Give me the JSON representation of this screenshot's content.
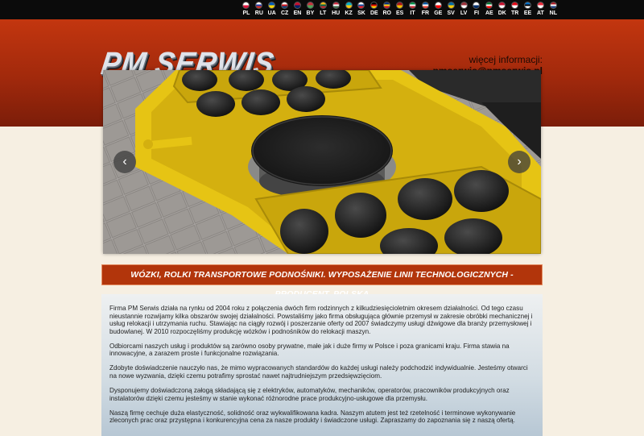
{
  "languages": [
    {
      "code": "PL",
      "colors": [
        "#ffffff",
        "#dc143c"
      ]
    },
    {
      "code": "RU",
      "colors": [
        "#ffffff",
        "#1c3fa8",
        "#d52b1e"
      ]
    },
    {
      "code": "UA",
      "colors": [
        "#0057b7",
        "#ffd700"
      ]
    },
    {
      "code": "CZ",
      "colors": [
        "#ffffff",
        "#d7141a",
        "#11457e"
      ]
    },
    {
      "code": "EN",
      "colors": [
        "#c8102e",
        "#012169"
      ]
    },
    {
      "code": "BY",
      "colors": [
        "#c8313e",
        "#4aa657"
      ]
    },
    {
      "code": "LT",
      "colors": [
        "#fdb913",
        "#006a44",
        "#c1272d"
      ]
    },
    {
      "code": "HU",
      "colors": [
        "#cd2a3e",
        "#ffffff",
        "#436f4d"
      ]
    },
    {
      "code": "KZ",
      "colors": [
        "#00afca",
        "#fec50c"
      ]
    },
    {
      "code": "SK",
      "colors": [
        "#ffffff",
        "#0b4ea2",
        "#ee1c25"
      ]
    },
    {
      "code": "DE",
      "colors": [
        "#000000",
        "#dd0000",
        "#ffce00"
      ]
    },
    {
      "code": "RO",
      "colors": [
        "#002b7f",
        "#fcd116",
        "#ce1126"
      ]
    },
    {
      "code": "ES",
      "colors": [
        "#aa151b",
        "#f1bf00"
      ]
    },
    {
      "code": "IT",
      "colors": [
        "#009246",
        "#ffffff",
        "#ce2b37"
      ]
    },
    {
      "code": "FR",
      "colors": [
        "#0055a4",
        "#ffffff",
        "#ef4135"
      ]
    },
    {
      "code": "GE",
      "colors": [
        "#ffffff",
        "#ff0000"
      ]
    },
    {
      "code": "SV",
      "colors": [
        "#006aa7",
        "#fecc00"
      ]
    },
    {
      "code": "LV",
      "colors": [
        "#9e3039",
        "#ffffff"
      ]
    },
    {
      "code": "FI",
      "colors": [
        "#ffffff",
        "#002f6c"
      ]
    },
    {
      "code": "AE",
      "colors": [
        "#00732f",
        "#ffffff",
        "#ff0000"
      ]
    },
    {
      "code": "DK",
      "colors": [
        "#c8102e",
        "#ffffff"
      ]
    },
    {
      "code": "TR",
      "colors": [
        "#e30a17",
        "#ffffff"
      ]
    },
    {
      "code": "EE",
      "colors": [
        "#0072ce",
        "#000000",
        "#ffffff"
      ]
    },
    {
      "code": "AT",
      "colors": [
        "#ed2939",
        "#ffffff"
      ]
    },
    {
      "code": "NL",
      "colors": [
        "#ae1c28",
        "#ffffff",
        "#21468b"
      ]
    }
  ],
  "header": {
    "logo_text": "PM SERWIS",
    "info_label": "więcej informacji:",
    "email": "pmserwis@pmserwis.pl"
  },
  "slider": {
    "prev_icon": "‹",
    "next_icon": "›"
  },
  "title_bar": "WÓZKI, ROLKI TRANSPORTOWE PODNOŚNIKI. WYPOSAŻENIE LINII TECHNOLOGICZNYCH - PRODUCENT, POLSKA",
  "paragraphs": [
    "Firma PM Serwis działa na rynku od 2004 roku z połączenia dwóch firm rodzinnych z kilkudziesięcioletnim okresem działalności. Od tego czasu nieustannie rozwijamy kilka obszarów swojej działalności. Powstaliśmy jako firma obsługująca głównie przemysł w zakresie obróbki mechanicznej i usług relokacji i utrzymania ruchu. Stawiając na ciągły rozwój i poszerzanie oferty od 2007 świadczymy usługi dźwigowe dla branży przemysłowej i budowlanej. W 2010 rozpoczęliśmy produkcję wózków i podnośników do relokacji maszyn.",
    "Odbiorcami naszych usług i produktów są zarówno osoby prywatne, małe jak i duże firmy w Polsce i poza granicami kraju. Firma stawia na innowacyjne, a zarazem proste i funkcjonalne rozwiązania.",
    "Zdobyte doświadczenie nauczyło nas, że mimo wypracowanych standardów do każdej usługi należy podchodzić indywidualnie. Jesteśmy otwarci na nowe wyzwania, dzięki czemu potrafimy sprostać nawet najtrudniejszym przedsięwzięciom.",
    "Dysponujemy doświadczoną załogą składającą się z elektryków, automatyków, mechaników, operatorów, pracowników produkcyjnych oraz instalatorów dzięki czemu jesteśmy w stanie wykonać różnorodne prace produkcyjno-usługowe dla przemysłu.",
    "Naszą firmę cechuje duża elastyczność, solidność oraz wykwalifikowana kadra. Naszym atutem jest też rzetelność i terminowe wykonywanie zleconych prac oraz przystępna i konkurencyjna cena za nasze produkty i świadczone usługi. Zapraszamy do zapoznania się z naszą ofertą."
  ]
}
